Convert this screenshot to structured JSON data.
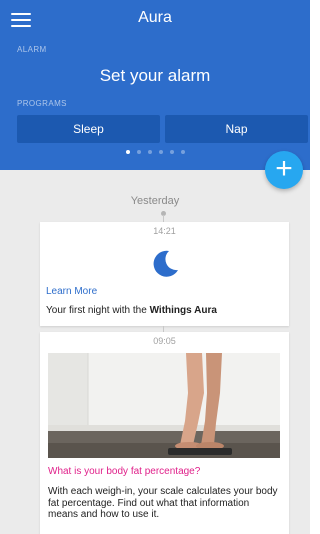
{
  "header": {
    "title": "Aura",
    "alarm_label": "ALARM",
    "set_alarm": "Set your alarm",
    "programs_label": "PROGRAMS",
    "programs": [
      "Sleep",
      "Nap"
    ],
    "page_count": 6,
    "active_page": 0
  },
  "fab": {
    "label": "+"
  },
  "timeline": {
    "day_label": "Yesterday",
    "cards": [
      {
        "time": "14:21",
        "icon": "moon-icon",
        "link": "Learn More",
        "text_prefix": "Your first night with the ",
        "text_bold": "Withings Aura"
      },
      {
        "time": "09:05",
        "image": "person-on-scale-photo",
        "title": "What is your body fat percentage?",
        "body": "With each weigh-in, your scale calculates your body fat percentage. Find out what that information means and how to use it."
      }
    ]
  },
  "colors": {
    "header_bg": "#2d6dcb",
    "program_button_bg": "#1c59b0",
    "fab_bg": "#27a7f0",
    "link": "#2d6dcb",
    "article_title": "#e0208a",
    "moon": "#2d6dcb"
  }
}
